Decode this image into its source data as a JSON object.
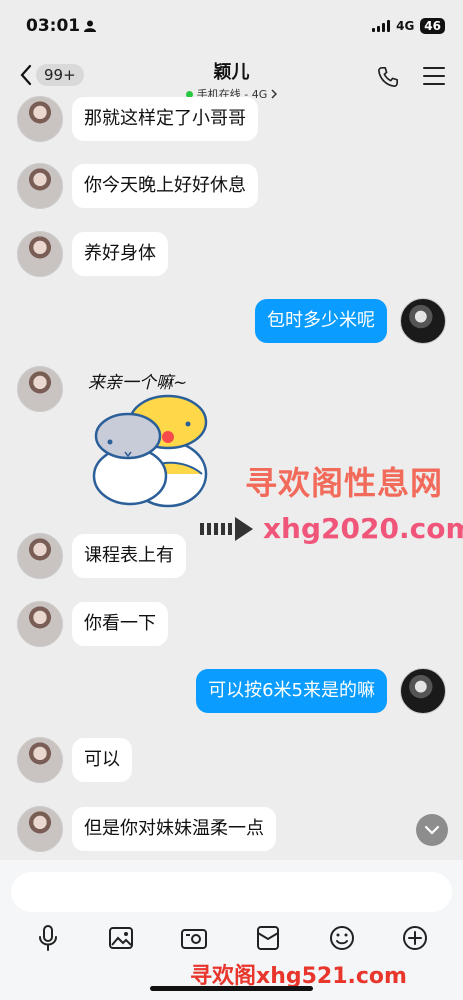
{
  "status": {
    "time": "03:01",
    "network": "4G",
    "battery": "46"
  },
  "nav": {
    "unread_count": "99+",
    "title": "颖儿",
    "subtitle": "手机在线 - 4G"
  },
  "messages": [
    {
      "side": "left",
      "text": "那就这样定了小哥哥"
    },
    {
      "side": "left",
      "text": "你今天晚上好好休息"
    },
    {
      "side": "left",
      "text": "养好身体"
    },
    {
      "side": "right",
      "text": "包时多少米呢"
    },
    {
      "side": "left",
      "text": "课程表上有"
    },
    {
      "side": "left",
      "text": "你看一下"
    },
    {
      "side": "right",
      "text": "可以按6米5来是的嘛"
    },
    {
      "side": "left",
      "text": "可以"
    },
    {
      "side": "left",
      "text": "但是你对妹妹温柔一点"
    }
  ],
  "sticker": {
    "caption": "来亲一个嘛~"
  },
  "watermarks": {
    "top": "寻欢阁性息网",
    "url": "xhg2020.com",
    "bottom": "寻欢阁xhg521.com"
  },
  "toolbar": [
    "microphone-icon",
    "image-icon",
    "camera-icon",
    "red-packet-icon",
    "emoji-icon",
    "plus-icon"
  ],
  "colors": {
    "my_bubble": "#0a9cff",
    "their_bubble": "#ffffff",
    "background": "#ededed",
    "online": "#28c840"
  }
}
